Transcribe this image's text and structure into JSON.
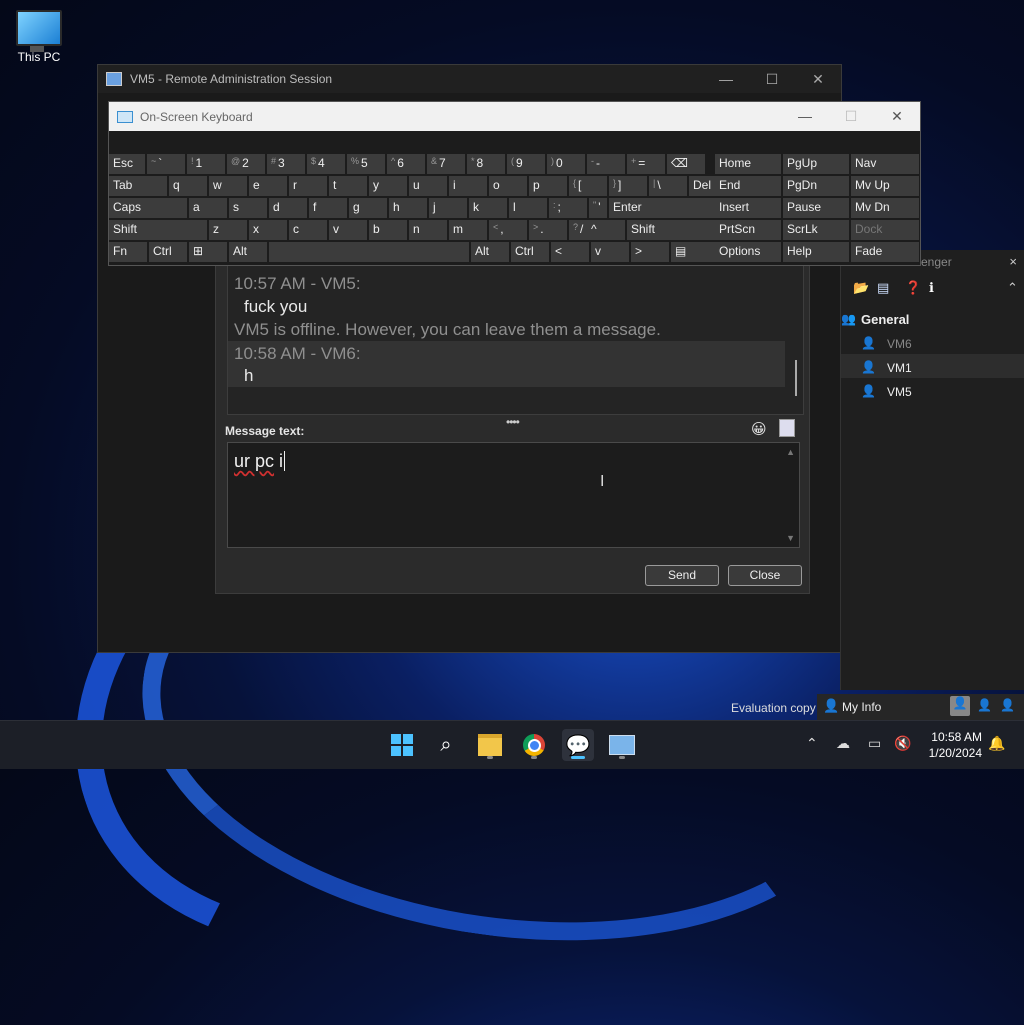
{
  "desktop": {
    "icon_label": "This PC"
  },
  "remote_window": {
    "title": "VM5 - Remote Administration Session"
  },
  "osk": {
    "title": "On-Screen Keyboard",
    "rows": [
      [
        {
          "t": "",
          "m": "Esc"
        },
        {
          "t": "~",
          "m": "`"
        },
        {
          "t": "!",
          "m": "1"
        },
        {
          "t": "@",
          "m": "2"
        },
        {
          "t": "#",
          "m": "3"
        },
        {
          "t": "$",
          "m": "4"
        },
        {
          "t": "%",
          "m": "5"
        },
        {
          "t": "^",
          "m": "6"
        },
        {
          "t": "&",
          "m": "7"
        },
        {
          "t": "*",
          "m": "8"
        },
        {
          "t": "(",
          "m": "9"
        },
        {
          "t": ")",
          "m": "0"
        },
        {
          "t": "-",
          "m": "-"
        },
        {
          "t": "+",
          "m": "="
        },
        {
          "t": "",
          "m": "⌫"
        }
      ],
      [
        {
          "t": "",
          "m": "Tab"
        },
        {
          "t": "",
          "m": "q"
        },
        {
          "t": "",
          "m": "w"
        },
        {
          "t": "",
          "m": "e"
        },
        {
          "t": "",
          "m": "r"
        },
        {
          "t": "",
          "m": "t"
        },
        {
          "t": "",
          "m": "y"
        },
        {
          "t": "",
          "m": "u"
        },
        {
          "t": "",
          "m": "i"
        },
        {
          "t": "",
          "m": "o"
        },
        {
          "t": "",
          "m": "p"
        },
        {
          "t": "{",
          "m": "["
        },
        {
          "t": "}",
          "m": "]"
        },
        {
          "t": "|",
          "m": "\\"
        },
        {
          "t": "",
          "m": "Del"
        }
      ],
      [
        {
          "t": "",
          "m": "Caps"
        },
        {
          "t": "",
          "m": "a"
        },
        {
          "t": "",
          "m": "s"
        },
        {
          "t": "",
          "m": "d"
        },
        {
          "t": "",
          "m": "f"
        },
        {
          "t": "",
          "m": "g"
        },
        {
          "t": "",
          "m": "h"
        },
        {
          "t": "",
          "m": "j"
        },
        {
          "t": "",
          "m": "k"
        },
        {
          "t": "",
          "m": "l"
        },
        {
          "t": ":",
          "m": ";"
        },
        {
          "t": "\"",
          "m": "'"
        },
        {
          "t": "",
          "m": "Enter"
        }
      ],
      [
        {
          "t": "",
          "m": "Shift"
        },
        {
          "t": "",
          "m": "z"
        },
        {
          "t": "",
          "m": "x"
        },
        {
          "t": "",
          "m": "c"
        },
        {
          "t": "",
          "m": "v"
        },
        {
          "t": "",
          "m": "b"
        },
        {
          "t": "",
          "m": "n"
        },
        {
          "t": "",
          "m": "m"
        },
        {
          "t": "<",
          "m": ","
        },
        {
          "t": ">",
          "m": "."
        },
        {
          "t": "?",
          "m": "/"
        },
        {
          "t": "",
          "m": "^"
        },
        {
          "t": "",
          "m": "Shift"
        }
      ],
      [
        {
          "t": "",
          "m": "Fn"
        },
        {
          "t": "",
          "m": "Ctrl"
        },
        {
          "t": "",
          "m": "⊞"
        },
        {
          "t": "",
          "m": "Alt"
        },
        {
          "t": "",
          "m": ""
        },
        {
          "t": "",
          "m": "Alt"
        },
        {
          "t": "",
          "m": "Ctrl"
        },
        {
          "t": "",
          "m": "<"
        },
        {
          "t": "",
          "m": "v"
        },
        {
          "t": "",
          "m": ">"
        },
        {
          "t": "",
          "m": "▤"
        }
      ]
    ],
    "nav": [
      [
        "Home",
        "PgUp",
        "Nav"
      ],
      [
        "End",
        "PgDn",
        "Mv Up"
      ],
      [
        "Insert",
        "Pause",
        "Mv Dn"
      ],
      [
        "PrtScn",
        "ScrLk",
        "Dock"
      ],
      [
        "Options",
        "Help",
        "Fade"
      ]
    ]
  },
  "chat": {
    "messages": [
      {
        "text": "10:57 AM - VM5:",
        "style": "gray"
      },
      {
        "text": "fuck you",
        "style": "body"
      },
      {
        "text": "VM5 is offline. However, you can leave them a message.",
        "style": "gray"
      },
      {
        "text": "10:58 AM - VM6:",
        "style": "gray"
      },
      {
        "text": "h",
        "style": "body"
      }
    ],
    "message_label": "Message text:",
    "input_value_underlined": "ur pc",
    "input_value_rest": " i",
    "send_label": "Send",
    "close_label": "Close"
  },
  "messenger": {
    "title_partial": "enger",
    "group": "General",
    "users": [
      {
        "name": "VM6",
        "offline": true
      },
      {
        "name": "VM1",
        "offline": false
      },
      {
        "name": "VM5",
        "offline": false
      }
    ],
    "my_info": "My Info",
    "evaluation": "Evaluation copy"
  },
  "taskbar": {
    "time": "10:58 AM",
    "date": "1/20/2024"
  },
  "colors": {
    "accent": "#3a8fd0",
    "chat_bg": "#2b2b2b",
    "key_bg": "#3c3c3c"
  }
}
